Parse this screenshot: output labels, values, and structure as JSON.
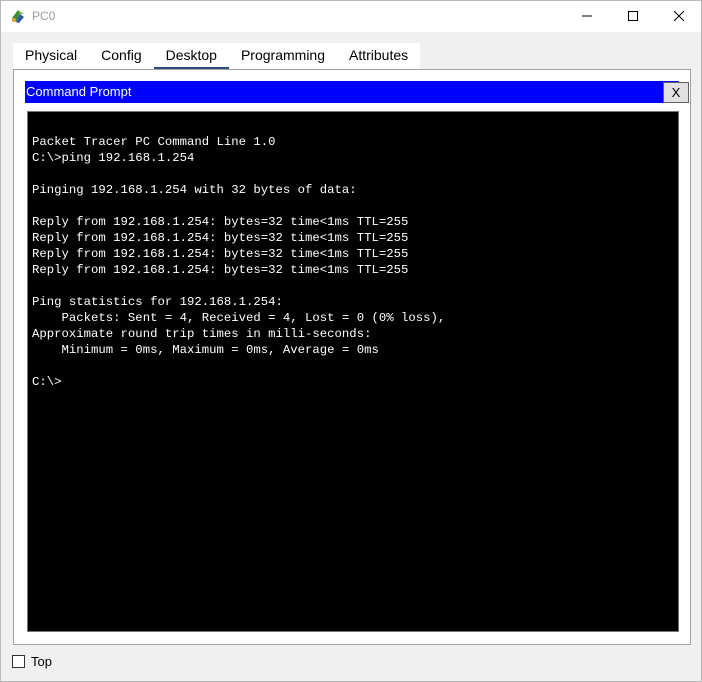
{
  "window": {
    "title": "PC0"
  },
  "tabs": [
    {
      "label": "Physical"
    },
    {
      "label": "Config"
    },
    {
      "label": "Desktop",
      "active": true
    },
    {
      "label": "Programming"
    },
    {
      "label": "Attributes"
    }
  ],
  "command_prompt": {
    "title": "Command Prompt",
    "close_label": "X",
    "lines": [
      "Packet Tracer PC Command Line 1.0",
      "C:\\>ping 192.168.1.254",
      "",
      "Pinging 192.168.1.254 with 32 bytes of data:",
      "",
      "Reply from 192.168.1.254: bytes=32 time<1ms TTL=255",
      "Reply from 192.168.1.254: bytes=32 time<1ms TTL=255",
      "Reply from 192.168.1.254: bytes=32 time<1ms TTL=255",
      "Reply from 192.168.1.254: bytes=32 time<1ms TTL=255",
      "",
      "Ping statistics for 192.168.1.254:",
      "    Packets: Sent = 4, Received = 4, Lost = 0 (0% loss),",
      "Approximate round trip times in milli-seconds:",
      "    Minimum = 0ms, Maximum = 0ms, Average = 0ms",
      "",
      "C:\\>"
    ]
  },
  "footer": {
    "top_label": "Top",
    "top_checked": false
  },
  "colors": {
    "header_bg": "#0000ff",
    "terminal_bg": "#000000",
    "terminal_fg": "#ffffff",
    "active_tab_underline": "#2b4c7e"
  },
  "icons": {
    "app": "packet-tracer-pc-icon",
    "minimize": "minimize-icon",
    "maximize": "maximize-icon",
    "close": "close-icon"
  }
}
